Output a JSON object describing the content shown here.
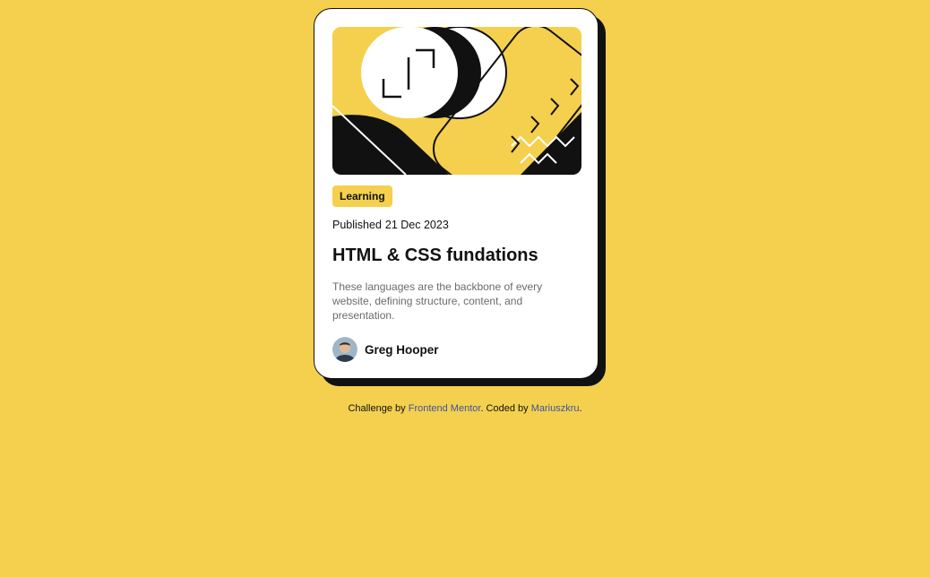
{
  "theme": {
    "page_bg": "#f4d04e",
    "card_bg": "#ffffff",
    "ink": "#111111",
    "muted": "#6b6b6b",
    "link": "#3e52a3"
  },
  "card": {
    "hero_image": "illustration-article",
    "tag": "Learning",
    "published_label": "Published",
    "published_date": "21 Dec 2023",
    "title": "HTML & CSS fundations",
    "description": "These languages are the backbone of every website, defining structure, content, and presentation.",
    "author": {
      "avatar": "avatar",
      "name": "Greg Hooper"
    }
  },
  "attribution": {
    "prefix": "Challenge by",
    "link1": "Frontend Mentor",
    "middle": ". Coded by",
    "link2": "Mariuszkru",
    "suffix": "."
  }
}
